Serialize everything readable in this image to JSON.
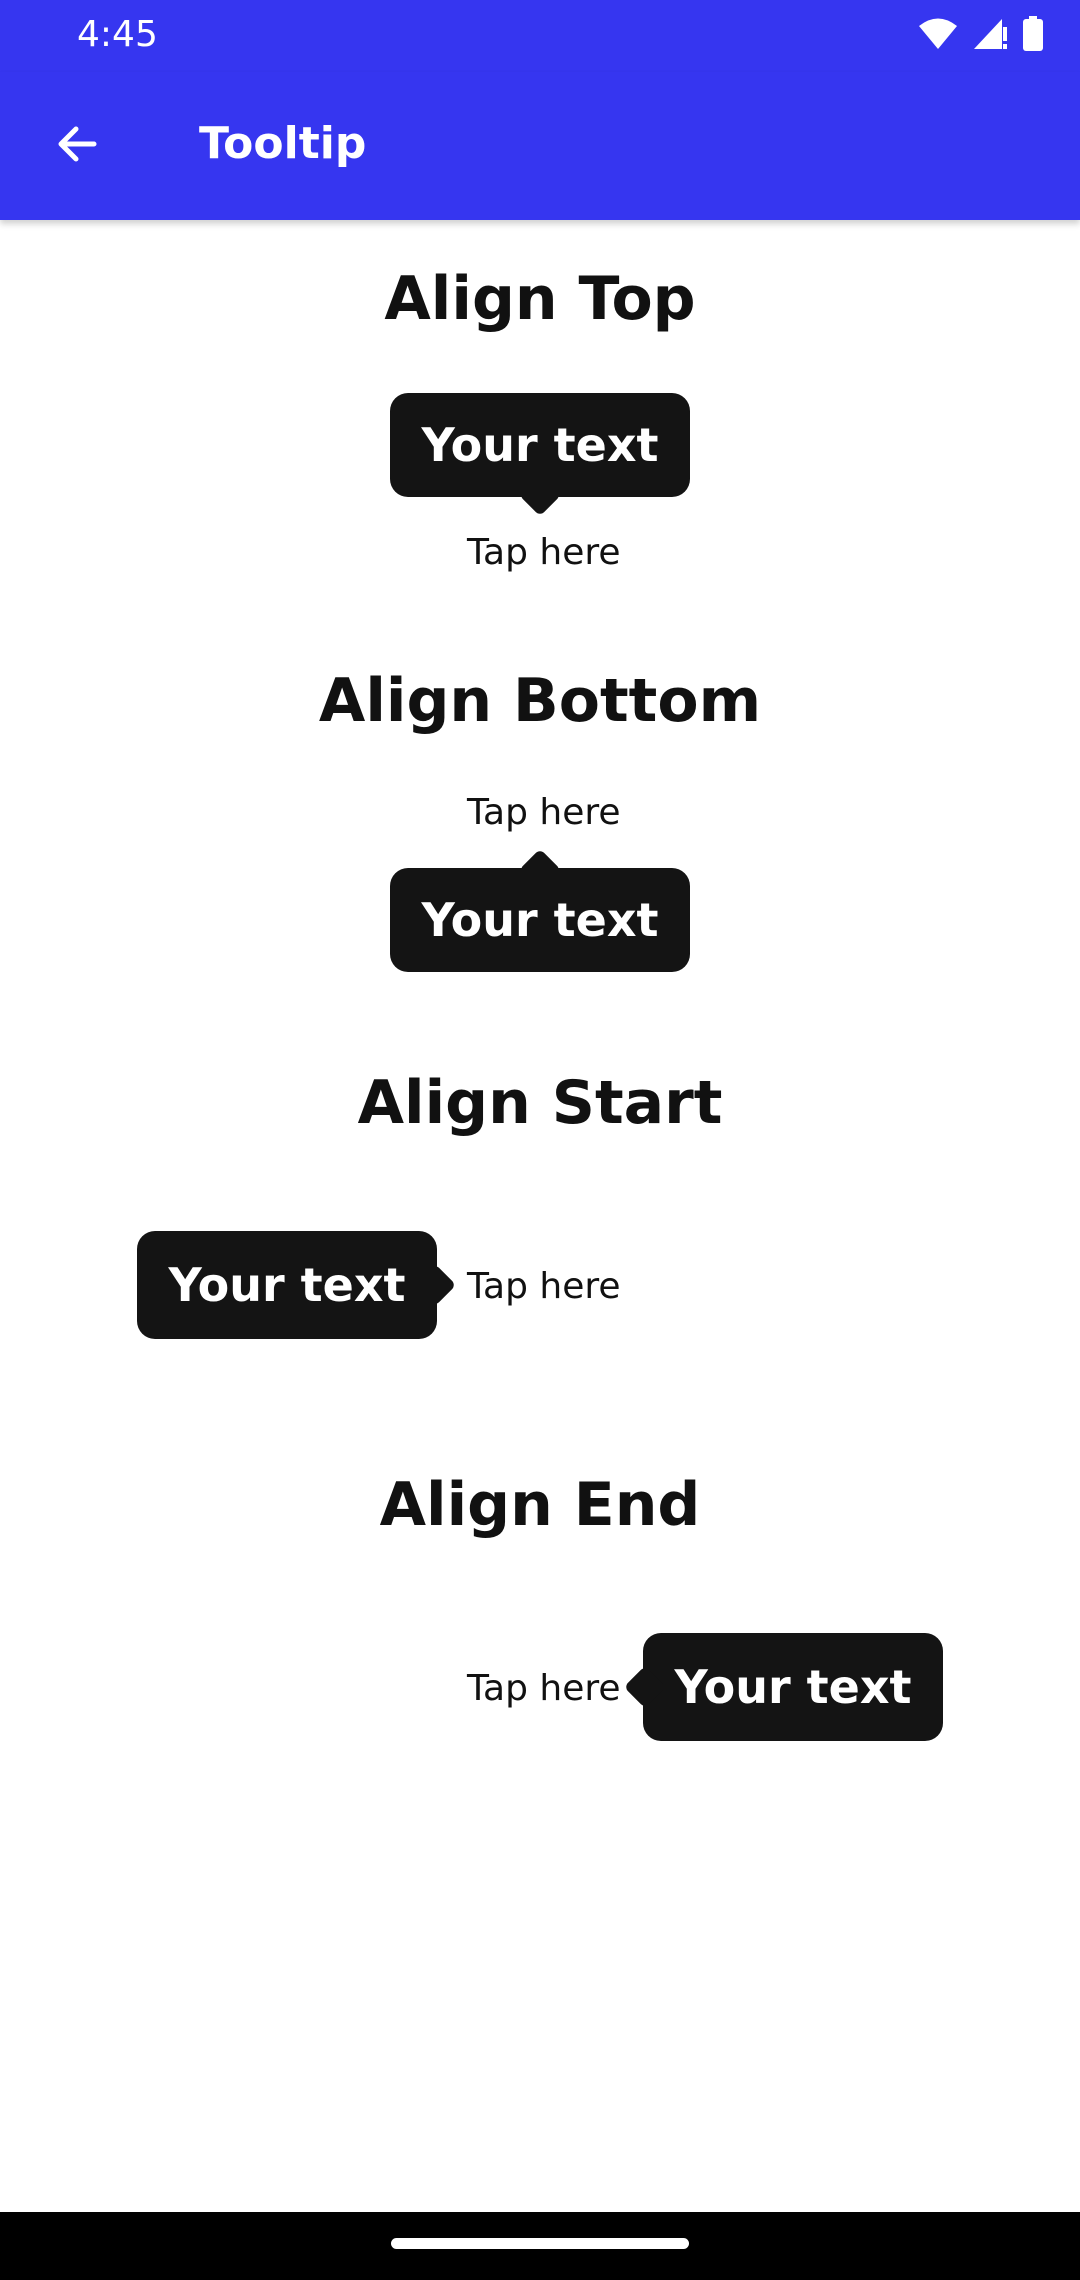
{
  "status_bar": {
    "time": "4:45",
    "icons": [
      "wifi-icon",
      "signal-icon",
      "battery-icon"
    ]
  },
  "app_bar": {
    "title": "Tooltip",
    "back_icon": "arrow-back-icon",
    "color": "#3636F0"
  },
  "sections": [
    {
      "title": "Align Top",
      "tooltip": "Your text",
      "anchor_label": "Tap here"
    },
    {
      "title": "Align Bottom",
      "tooltip": "Your text",
      "anchor_label": "Tap here"
    },
    {
      "title": "Align Start",
      "tooltip": "Your text",
      "anchor_label": "Tap here"
    },
    {
      "title": "Align End",
      "tooltip": "Your text",
      "anchor_label": "Tap here"
    }
  ],
  "colors": {
    "tooltip_background": "#141414",
    "text": "#111111"
  }
}
